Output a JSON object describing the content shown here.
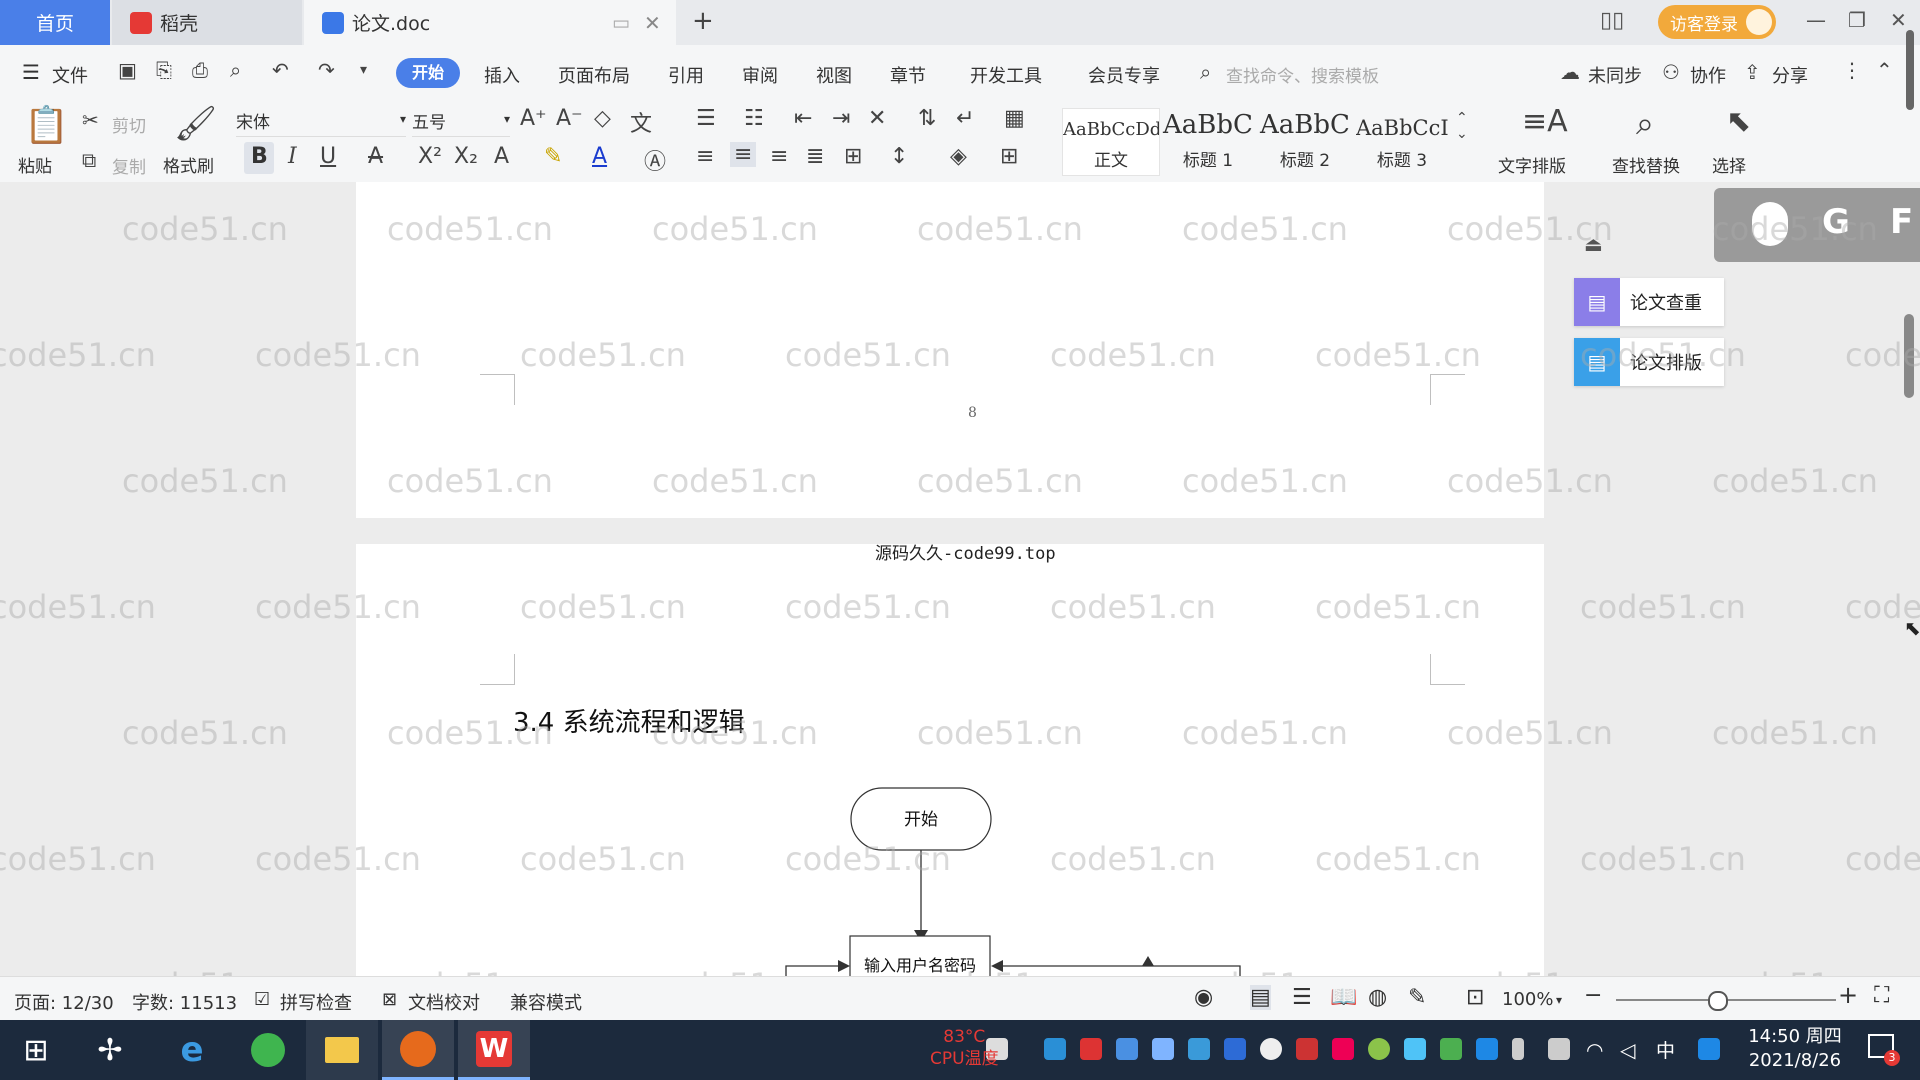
{
  "tabs": {
    "home": "首页",
    "daoke": "稻壳",
    "doc": "论文.doc",
    "guest_login": "访客登录"
  },
  "menu": {
    "file": "文件",
    "start": "开始",
    "insert": "插入",
    "layout": "页面布局",
    "reference": "引用",
    "review": "审阅",
    "view": "视图",
    "chapter": "章节",
    "devtools": "开发工具",
    "member": "会员专享",
    "search_placeholder": "查找命令、搜索模板",
    "unsynced": "未同步",
    "collab": "协作",
    "share": "分享"
  },
  "ribbon": {
    "paste": "粘贴",
    "cut": "剪切",
    "copy": "复制",
    "format_painter": "格式刷",
    "font_name": "宋体",
    "font_size": "五号",
    "styles": [
      {
        "preview": "AaBbCcDd",
        "label": "正文"
      },
      {
        "preview": "AaBbC",
        "label": "标题 1"
      },
      {
        "preview": "AaBbC",
        "label": "标题 2"
      },
      {
        "preview": "AaBbCcI",
        "label": "标题 3"
      }
    ],
    "text_layout": "文字排版",
    "find_replace": "查找替换",
    "select": "选择"
  },
  "document": {
    "page_number": "8",
    "between_pages_text": "源码久久-code99.top",
    "heading": "3.4 系统流程和逻辑",
    "flow_start": "开始",
    "flow_input": "输入用户名密码"
  },
  "side_panel": {
    "check": "论文查重",
    "layout": "论文排版",
    "overlay_letters": [
      "G",
      "F"
    ]
  },
  "watermark": "code51.cn",
  "status": {
    "page": "页面: 12/30",
    "words": "字数: 11513",
    "spell": "拼写检查",
    "proof": "文档校对",
    "compat": "兼容模式",
    "zoom": "100%"
  },
  "taskbar": {
    "cpu_temp": "83°C",
    "cpu_label": "CPU温度",
    "time": "14:50 周四",
    "date": "2021/8/26",
    "ime": "中",
    "notif_count": "3"
  },
  "colors": {
    "accent": "#4a7fe8",
    "guest": "#f2a93b",
    "taskbar": "#1c2a3d"
  }
}
